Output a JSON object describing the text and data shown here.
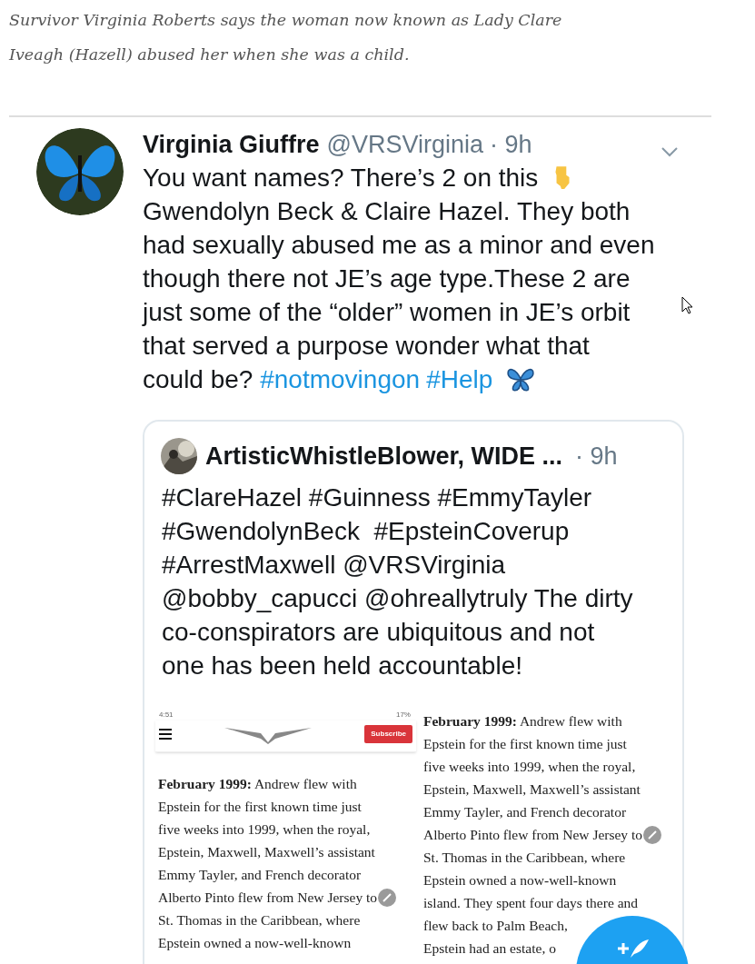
{
  "caption": "Survivor Virginia Roberts says the woman now known as Lady Clare Iveagh (Hazell) abused her when she was a child.",
  "tweet": {
    "name": "Virginia Giuffre",
    "handle": "@VRSVirginia",
    "time": "· 9h",
    "lines": [
      [
        {
          "kind": "text",
          "text": "You want names? There’s 2 on this"
        },
        {
          "kind": "pointing_emoji"
        }
      ],
      [
        {
          "kind": "text",
          "text": "Gwendolyn Beck & Claire Hazel. They both"
        }
      ],
      [
        {
          "kind": "text",
          "text": "had sexually abused me as a minor and even"
        }
      ],
      [
        {
          "kind": "text",
          "text": "though there not JE’s age type.These 2 are"
        }
      ],
      [
        {
          "kind": "text",
          "text": "just some of the “older” women in JE’s orbit"
        }
      ],
      [
        {
          "kind": "text",
          "text": "that served a purpose wonder what that"
        }
      ],
      [
        {
          "kind": "text",
          "text": "could be?"
        },
        {
          "kind": "hashtag",
          "text": "#notmovingon"
        },
        {
          "kind": "hashtag",
          "text": "#Help"
        },
        {
          "kind": "butterfly_emoji"
        }
      ]
    ],
    "quote": {
      "name": "ArtisticWhistleBlower, WIDE ...",
      "time": "· 9h",
      "lines": [
        "#ClareHazel #Guinness #EmmyTayler",
        "#GwendolynBeck  #EpsteinCoverup",
        "#ArrestMaxwell @VRSVirginia",
        "@bobby_capucci @ohreallytruly The dirty",
        "co-conspirators are ubiquitous and not",
        "one has been held accountable!"
      ],
      "phone": {
        "clock": "4:51",
        "battery": "17%",
        "button": "Subscribe",
        "lines": [
          "**February 1999:** Andrew flew with",
          "Epstein for the first known time just",
          "five weeks into 1999, when the royal,",
          "Epstein, Maxwell, Maxwell’s assistant",
          "Emmy Tayler, and French decorator",
          "Alberto Pinto flew from New Jersey to",
          "St. Thomas in the Caribbean, where",
          "Epstein owned a now-well-known"
        ]
      },
      "article": {
        "lines": [
          "**February 1999:** Andrew flew with",
          "Epstein for the first known time just",
          "five weeks into 1999, when the royal,",
          "Epstein, Maxwell, Maxwell’s assistant",
          "Emmy Tayler, and French decorator",
          "Alberto Pinto flew from New Jersey to",
          "St. Thomas in the Caribbean, where",
          "Epstein owned a now-well-known",
          "island. They spent four days there and",
          "flew back to Palm Beach,",
          "Epstein had an estate, o"
        ]
      }
    }
  }
}
